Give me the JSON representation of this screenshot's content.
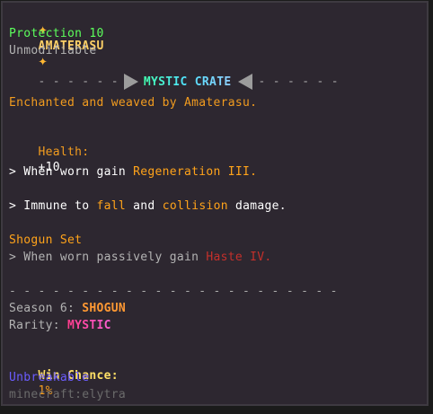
{
  "item": {
    "star_left": "✦",
    "name": "AMATERASU",
    "star_right": "✦",
    "enchant": "Protection 10",
    "unmodifiable": "Unmodifiable",
    "header_dashes_left": "- - - - - -",
    "crate_label": "MYSTIC CRATE",
    "header_dashes_right": "- - - - - -",
    "description": "Enchanted and weaved by Amaterasu.",
    "health_label": "Health:",
    "health_value": "+10",
    "ability1_prefix": "> When worn gain ",
    "ability1_effect": "Regeneration III.",
    "ability2_prefix": "> Immune to ",
    "ability2_fall": "fall",
    "ability2_and": " and ",
    "ability2_collision": "collision",
    "ability2_suffix": " damage.",
    "set_title": "Shogun Set",
    "set_prefix": "> When worn passively gain ",
    "set_effect": "Haste IV.",
    "footer_dashes": "- - - - - - - - - - - - - - - - - - - - - - -",
    "season_label": "Season 6: ",
    "season_value": "SHOGUN",
    "rarity_label": "Rarity: ",
    "rarity_value": "MYSTIC",
    "win_label": "Win Chance:",
    "win_value": "1%",
    "unbreakable": "Unbreakable",
    "item_id": "minecraft:elytra"
  }
}
